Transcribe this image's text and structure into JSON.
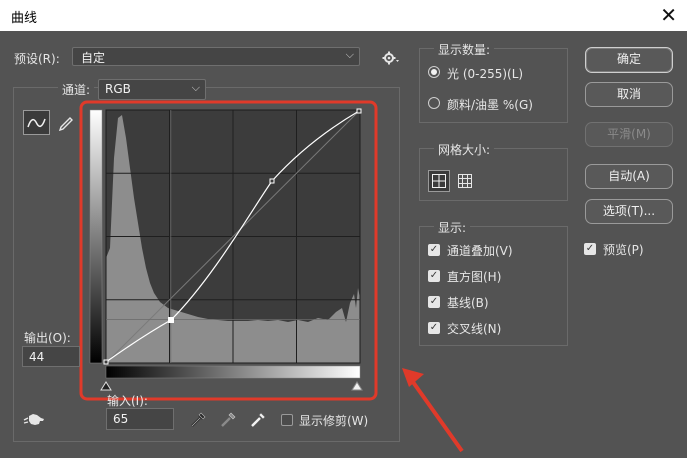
{
  "window": {
    "title": "曲线",
    "close_icon": "close-icon"
  },
  "preset": {
    "label": "预设(R):",
    "value": "自定"
  },
  "channel": {
    "label": "通道:",
    "value": "RGB"
  },
  "output": {
    "label": "输出(O):",
    "value": "44"
  },
  "input": {
    "label": "输入(I):",
    "value": "65"
  },
  "clipping": {
    "label": "显示修剪(W)",
    "checked": false
  },
  "display_amount": {
    "title": "显示数量:",
    "options": [
      {
        "label": "光 (0-255)(L)",
        "selected": true
      },
      {
        "label": "颜料/油墨 %(G)",
        "selected": false
      }
    ]
  },
  "grid_size": {
    "title": "网格大小:"
  },
  "show": {
    "title": "显示:",
    "items": [
      {
        "label": "通道叠加(V)",
        "checked": true
      },
      {
        "label": "直方图(H)",
        "checked": true
      },
      {
        "label": "基线(B)",
        "checked": true
      },
      {
        "label": "交叉线(N)",
        "checked": true
      }
    ]
  },
  "buttons": {
    "ok": "确定",
    "cancel": "取消",
    "smooth": "平滑(M)",
    "auto": "自动(A)",
    "options": "选项(T)..."
  },
  "preview": {
    "label": "预览(P)",
    "checked": true
  },
  "curve": {
    "points": [
      [
        0,
        0
      ],
      [
        65,
        44
      ],
      [
        167,
        183
      ],
      [
        255,
        255
      ]
    ]
  },
  "colors": {
    "annotation": "#e03a2a",
    "accent": "#e6e6e6"
  }
}
